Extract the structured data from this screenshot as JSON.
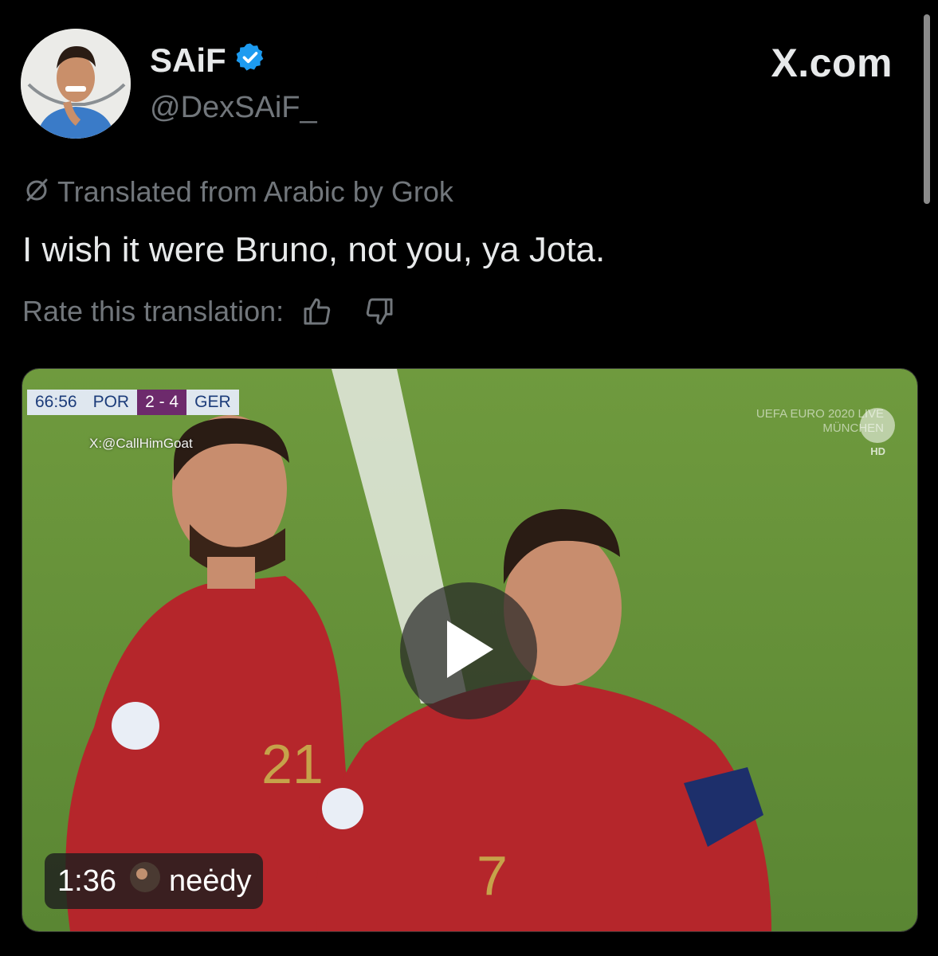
{
  "header": {
    "display_name": "SAiF",
    "handle": "@DexSAiF_",
    "site": "X.com",
    "verified_color": "#1d9bf0"
  },
  "tweet": {
    "translation_label": "Translated from Arabic by Grok",
    "text": "I wish it were Bruno, not you, ya Jota.",
    "rate_label": "Rate this translation:"
  },
  "media": {
    "scorebug": {
      "time": "66:56",
      "home": "POR",
      "score": "2 - 4",
      "away": "GER"
    },
    "watermark": "X:@CallHimGoat",
    "broadcast_line1": "UEFA EURO 2020 LIVE",
    "broadcast_line2": "MÜNCHEN",
    "hd": "HD",
    "shirt_left": "21",
    "shirt_right": "7",
    "duration": "1:36",
    "poster": "neėdy"
  },
  "icons": {
    "verified": "verified-badge-icon",
    "translate": "slashed-circle-icon",
    "thumbs_up": "thumbs-up-icon",
    "thumbs_down": "thumbs-down-icon",
    "play": "play-icon"
  }
}
